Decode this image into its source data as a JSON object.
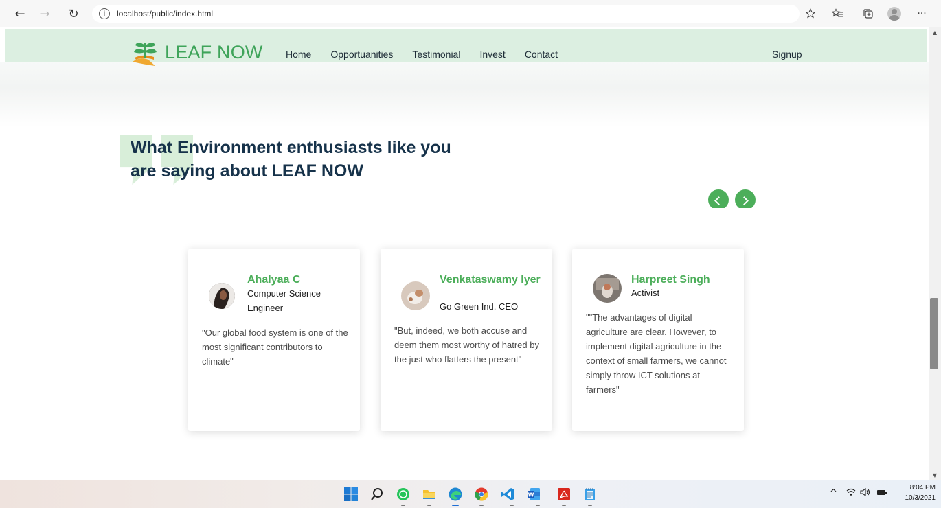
{
  "browser": {
    "url": "localhost/public/index.html",
    "back_icon": "←",
    "forward_icon": "→",
    "refresh_icon": "↻",
    "info_icon": "i",
    "more_icon": "···"
  },
  "header": {
    "logo_text": "LEAF NOW",
    "nav": [
      "Home",
      "Opportuanities",
      "Testimonial",
      "Invest",
      "Contact"
    ],
    "signup": "Signup"
  },
  "testimonials": {
    "title_line1": "What Environment enthusiasts like you",
    "title_line2": "are saying about LEAF NOW",
    "cards": [
      {
        "name": "Ahalyaa C",
        "role": "Computer Science Engineer",
        "quote": "\"Our global food system is one of the most significant contributors to climate\""
      },
      {
        "name": "Venkataswamy Iyer",
        "role": "Go Green Ind, CEO",
        "quote": "\"But, indeed, we both accuse and deem them most worthy of hatred by the just who flatters the present\""
      },
      {
        "name": "Harpreet Singh",
        "role": "Activist",
        "quote": "\"\"The advantages of digital agriculture are clear. However, to implement digital agriculture in the context of small farmers, we cannot simply throw ICT solutions at farmers\""
      }
    ]
  },
  "taskbar": {
    "time": "8:04 PM",
    "date": "10/3/2021",
    "tray_chevron": "^"
  },
  "colors": {
    "brand_green": "#4cae5a",
    "header_bg": "#dcefe1",
    "title_navy": "#16324a"
  }
}
